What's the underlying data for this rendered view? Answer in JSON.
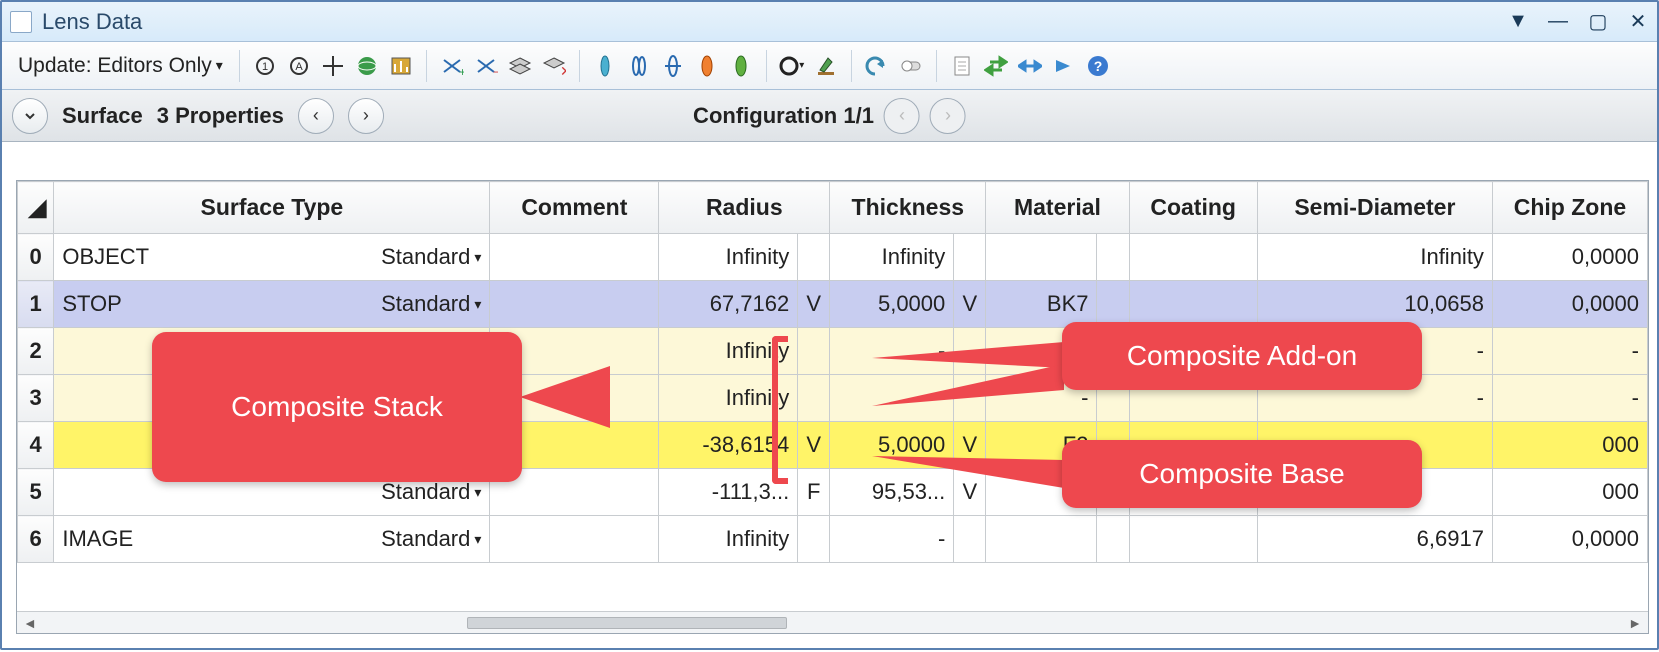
{
  "window": {
    "title": "Lens Data"
  },
  "toolbar": {
    "update_label": "Update: Editors Only"
  },
  "propbar": {
    "surface_label": "Surface",
    "properties_label": "3 Properties",
    "config_label": "Configuration 1/1"
  },
  "columns": {
    "surface_type": "Surface Type",
    "comment": "Comment",
    "radius": "Radius",
    "thickness": "Thickness",
    "material": "Material",
    "coating": "Coating",
    "semi_diameter": "Semi-Diameter",
    "chip_zone": "Chip Zone"
  },
  "rows": [
    {
      "idx": "0",
      "name": "OBJECT",
      "type": "Standard",
      "type_dd": true,
      "radius": "Infinity",
      "radius_flag": "",
      "thickness": "Infinity",
      "thickness_flag": "",
      "material": "",
      "material_flag": "",
      "coating": "",
      "semi": "Infinity",
      "chip": "0,0000",
      "class": ""
    },
    {
      "idx": "1",
      "name": "STOP",
      "type": "Standard",
      "type_dd": true,
      "radius": "67,7162",
      "radius_flag": "V",
      "thickness": "5,0000",
      "thickness_flag": "V",
      "material": "BK7",
      "material_flag": "",
      "coating": "",
      "semi": "10,0658",
      "chip": "0,0000",
      "class": "sel"
    },
    {
      "idx": "2",
      "name": "",
      "type": "",
      "type_dd": false,
      "radius": "Infinity",
      "radius_flag": "",
      "thickness": "-",
      "thickness_flag": "",
      "material": "-",
      "material_flag": "",
      "coating": "",
      "semi": "-",
      "chip": "-",
      "class": "pale"
    },
    {
      "idx": "3",
      "name": "",
      "type": "",
      "type_dd": false,
      "radius": "Infinity",
      "radius_flag": "",
      "thickness": "-",
      "thickness_flag": "",
      "material": "-",
      "material_flag": "",
      "coating": "",
      "semi": "-",
      "chip": "-",
      "class": "pale"
    },
    {
      "idx": "4",
      "name": "",
      "type": "",
      "type_dd": false,
      "radius": "-38,6154",
      "radius_flag": "V",
      "thickness": "5,0000",
      "thickness_flag": "V",
      "material": "F2",
      "material_flag": "",
      "coating": "",
      "semi": "",
      "chip": "000",
      "class": "bright"
    },
    {
      "idx": "5",
      "name": "",
      "type": "Standard",
      "type_dd": true,
      "radius": "-111,3...",
      "radius_flag": "F",
      "thickness": "95,53...",
      "thickness_flag": "V",
      "material": "",
      "material_flag": "",
      "coating": "",
      "semi": "",
      "chip": "000",
      "class": ""
    },
    {
      "idx": "6",
      "name": "IMAGE",
      "type": "Standard",
      "type_dd": true,
      "radius": "Infinity",
      "radius_flag": "",
      "thickness": "-",
      "thickness_flag": "",
      "material": "",
      "material_flag": "",
      "coating": "",
      "semi": "6,6917",
      "chip": "0,0000",
      "class": ""
    }
  ],
  "callouts": {
    "stack": "Composite Stack",
    "addon": "Composite Add-on",
    "base": "Composite Base"
  }
}
